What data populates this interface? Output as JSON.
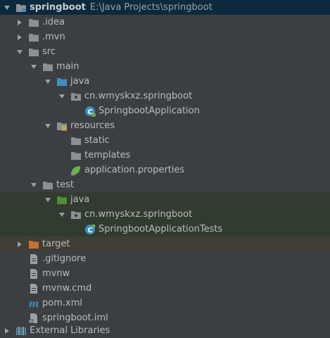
{
  "project": {
    "name": "springboot",
    "path": "E:\\Java Projects\\springboot"
  },
  "tree": {
    "idea": ".idea",
    "mvn": ".mvn",
    "src": "src",
    "main": "main",
    "main_java": "java",
    "main_package": "cn.wmyskxz.springboot",
    "main_class": "SpringbootApplication",
    "resources": "resources",
    "static": "static",
    "templates": "templates",
    "app_properties": "application.properties",
    "test": "test",
    "test_java": "java",
    "test_package": "cn.wmyskxz.springboot",
    "test_class": "SpringbootApplicationTests",
    "target": "target",
    "gitignore": ".gitignore",
    "mvnw": "mvnw",
    "mvnw_cmd": "mvnw.cmd",
    "pom": "pom.xml",
    "iml": "springboot.iml",
    "external_libraries": "External Libraries"
  },
  "colors": {
    "background": "#3c3f41",
    "selection": "#0d293e",
    "test_highlight": "#323b2f",
    "target_highlight": "#413e38",
    "folder": "#8c9093",
    "source_folder": "#3d8fbf",
    "test_folder": "#4e8f3a",
    "target_folder": "#c67233",
    "spring_green": "#6db33f"
  }
}
